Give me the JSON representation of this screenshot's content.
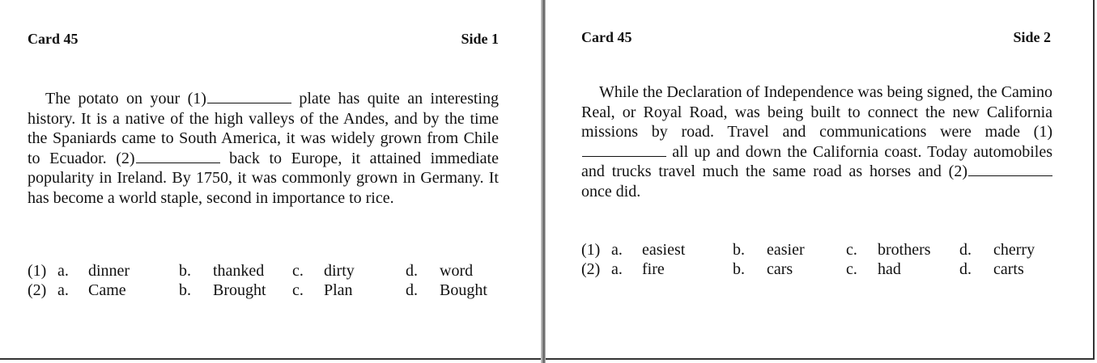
{
  "cards": [
    {
      "title": "Card 45",
      "side": "Side 1",
      "passage": {
        "p1": "The potato on your (1)",
        "p2": " plate has quite an interesting history. It is a native of the high valleys of the Andes, and by the time the Spaniards came to South America, it was widely grown from Chile to Ecuador. (2)",
        "p3": " back to Europe, it attained immediate popularity in Ireland. By 1750, it was commonly grown in Germany. It has become a world staple, second in importance to rice."
      },
      "questions": [
        {
          "number": "(1)",
          "options": [
            {
              "letter": "a.",
              "text": "dinner"
            },
            {
              "letter": "b.",
              "text": "thanked"
            },
            {
              "letter": "c.",
              "text": "dirty"
            },
            {
              "letter": "d.",
              "text": "word"
            }
          ]
        },
        {
          "number": "(2)",
          "options": [
            {
              "letter": "a.",
              "text": "Came"
            },
            {
              "letter": "b.",
              "text": "Brought"
            },
            {
              "letter": "c.",
              "text": "Plan"
            },
            {
              "letter": "d.",
              "text": "Bought"
            }
          ]
        }
      ]
    },
    {
      "title": "Card 45",
      "side": "Side 2",
      "passage": {
        "p1": "While the Declaration of Independence was being signed, the Camino Real, or Royal Road, was being built to connect the new California missions by road. Travel and communications were made (1)",
        "p2": " all up and down the California coast. Today automobiles and trucks travel much the same road as horses and (2)",
        "p3": " once did."
      },
      "questions": [
        {
          "number": "(1)",
          "options": [
            {
              "letter": "a.",
              "text": "easiest"
            },
            {
              "letter": "b.",
              "text": "easier"
            },
            {
              "letter": "c.",
              "text": "brothers"
            },
            {
              "letter": "d.",
              "text": "cherry"
            }
          ]
        },
        {
          "number": "(2)",
          "options": [
            {
              "letter": "a.",
              "text": "fire"
            },
            {
              "letter": "b.",
              "text": "cars"
            },
            {
              "letter": "c.",
              "text": "had"
            },
            {
              "letter": "d.",
              "text": "carts"
            }
          ]
        }
      ]
    }
  ]
}
